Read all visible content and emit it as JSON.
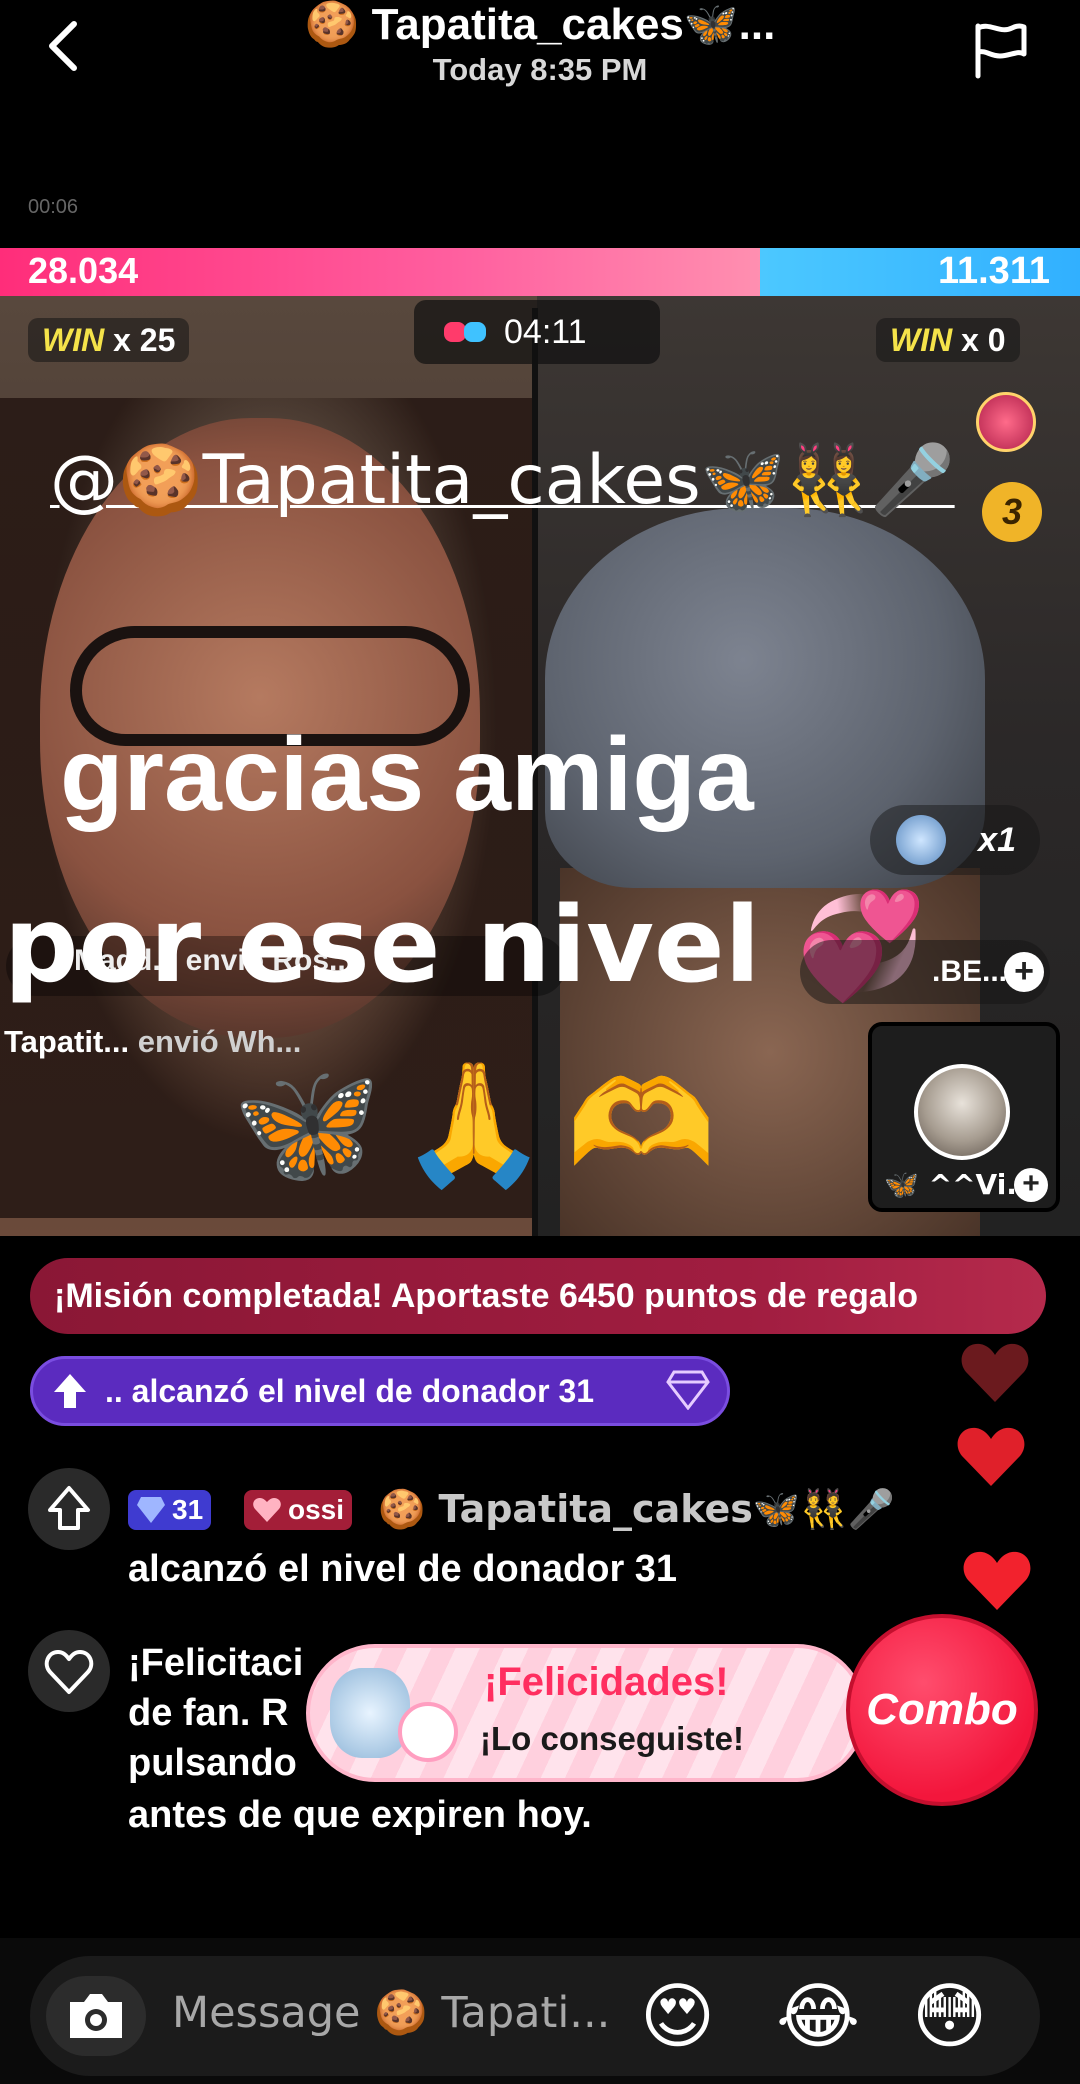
{
  "header": {
    "title": "🍪 Tapatita_cakes🦋...",
    "subtitle": "Today 8:35 PM"
  },
  "recording": "00:06",
  "battle": {
    "score_left": "28.034",
    "score_right": "11.311",
    "win_left_label": "WIN",
    "win_left_count": "x 25",
    "win_right_label": "WIN",
    "win_right_count": "x 0",
    "timer": "04:11",
    "rank_badge": "3"
  },
  "stream_overlay": {
    "mention": "@🍪Tapatita_cakes🦋👯‍♀️🎤",
    "caption_line1": "gracias amiga",
    "caption_line2": "por ese nivel 💞",
    "gift_combo": "x1",
    "left_gifter_text": "Magd... envió Ros...",
    "left_gift_notice_name": "Tapatit...",
    "left_gift_notice_action": "envió Wh...",
    "right_pill_name": ".BE...",
    "guest_name": "🦋 ^^Vi...",
    "emoji_row": "🦋🙏🫶"
  },
  "chat": {
    "mission_banner": "¡Misión completada! Aportaste 6450 puntos de regalo",
    "level_banner": ".. alcanzó el nivel de donador 31",
    "level_message": {
      "badge_level": "31",
      "badge_fan": "ossi",
      "username": "🍪 Tapatita_cakes🦋👯🎤",
      "text": "alcanzó el nivel de donador 31"
    },
    "fan_message": {
      "line1": "¡Felicitaci",
      "line2": "de fan. R",
      "line3": "pulsando",
      "line4": "antes de que expiren hoy."
    }
  },
  "celebration": {
    "title": "¡Felicidades!",
    "subtitle": "¡Lo conseguiste!",
    "combo_label": "Combo"
  },
  "composer": {
    "placeholder": "Message 🍪 Tapati...",
    "reactions": [
      "😍",
      "😂",
      "😳"
    ]
  },
  "colors": {
    "score_left": "#ff2d7a",
    "score_right": "#4cc8ff",
    "mission_banner": "#a01d40",
    "level_banner": "#5b2bbf",
    "combo": "#f3163c"
  }
}
